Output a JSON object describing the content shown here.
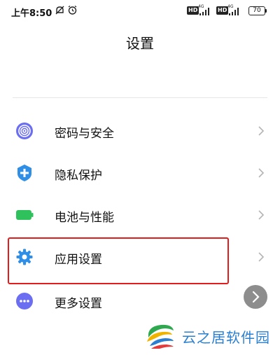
{
  "status_bar": {
    "time": "上午8:50",
    "hd_label": "HD",
    "network": "4G",
    "battery": "70",
    "icons": [
      "mute-icon",
      "alarm-icon",
      "signal-icon",
      "battery-icon"
    ]
  },
  "header": {
    "title": "设置"
  },
  "settings": {
    "items": [
      {
        "label": "密码与安全",
        "icon": "fingerprint-icon",
        "icon_color": "#6b6ef0"
      },
      {
        "label": "隐私保护",
        "icon": "shield-icon",
        "icon_color": "#2f8fe6"
      },
      {
        "label": "电池与性能",
        "icon": "battery-icon",
        "icon_color": "#2fc25c"
      },
      {
        "label": "应用设置",
        "icon": "gear-icon",
        "icon_color": "#2f8fe6"
      },
      {
        "label": "更多设置",
        "icon": "more-dots-icon",
        "icon_color": "#6b6ef0"
      }
    ],
    "highlighted_item": "应用设置"
  },
  "watermark": {
    "text": "云之居软件园"
  },
  "colors": {
    "highlight": "#e31d1d",
    "chevron": "#b5b5b5",
    "watermark_text": "#2a7fd0"
  }
}
